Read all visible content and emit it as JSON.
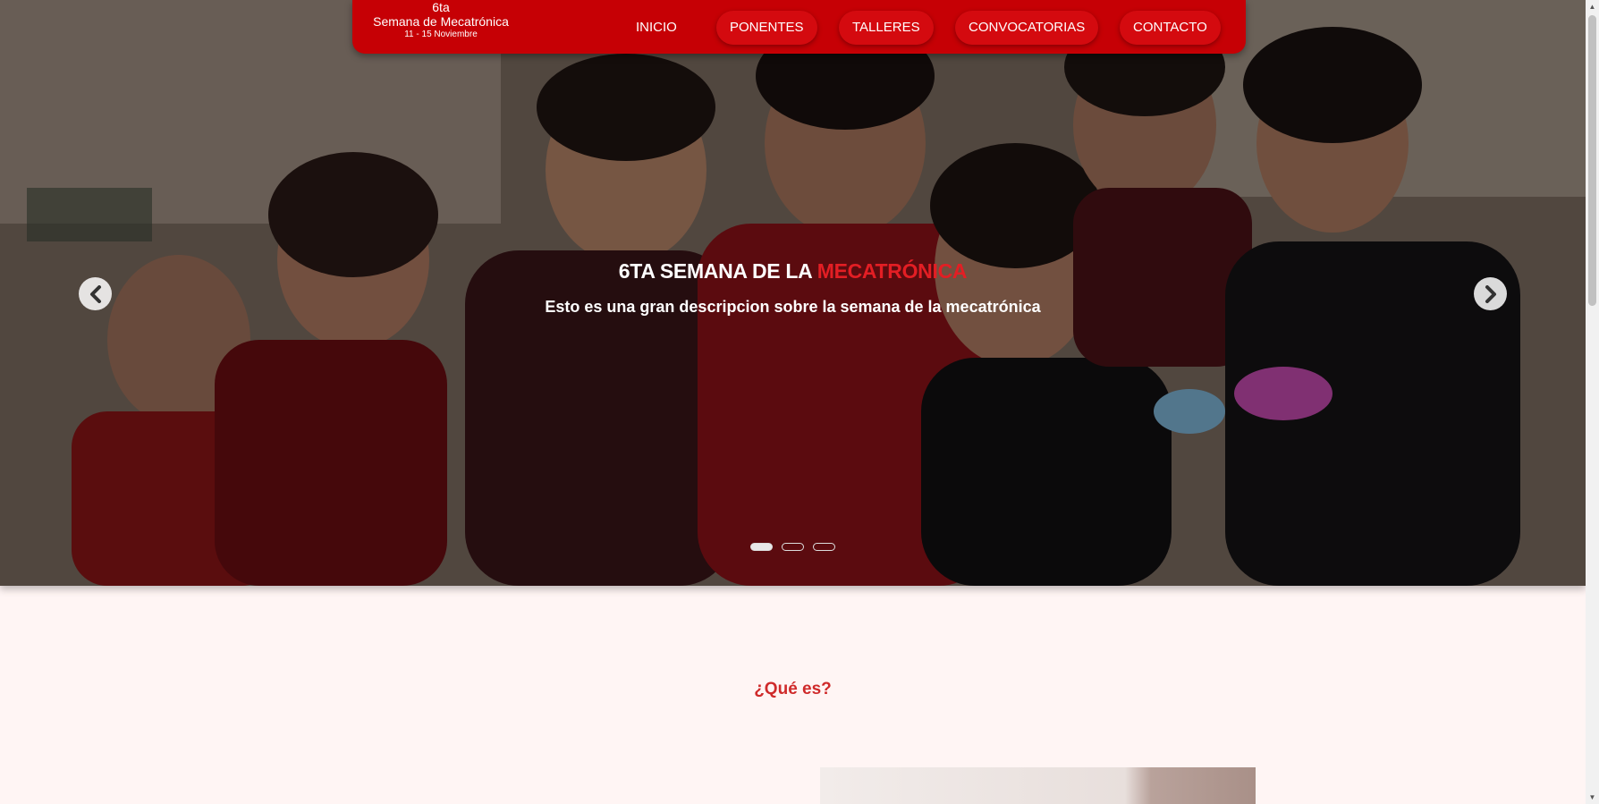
{
  "brand": {
    "line1": "6ta",
    "line2": "Semana de Mecatrónica",
    "dates": "11 - 15 Noviembre"
  },
  "nav": {
    "items": [
      "INICIO",
      "PONENTES",
      "TALLERES",
      "CONVOCATORIAS",
      "CONTACTO"
    ]
  },
  "hero": {
    "title_main": "6TA SEMANA DE LA ",
    "title_accent": "MECATRÓNICA",
    "description": "Esto es una gran descripcion sobre la semana de la mecatrónica",
    "prev_icon": "chevron-left-icon",
    "next_icon": "chevron-right-icon",
    "slides_total": 3,
    "active_slide": 1
  },
  "section": {
    "title": "¿Qué es?"
  },
  "colors": {
    "brand_red": "#c60005",
    "accent_red": "#e31e24",
    "section_title": "#cf2a2a",
    "page_bg": "#fff5f4"
  }
}
